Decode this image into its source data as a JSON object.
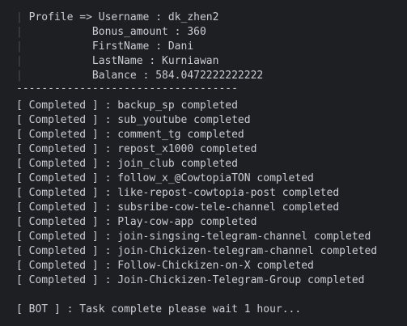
{
  "profile": {
    "prefix": "Profile => ",
    "bar": "|",
    "rows": [
      {
        "text": "Username : dk_zhen2"
      },
      {
        "text": "Bonus_amount : 360"
      },
      {
        "text": "FirstName : Dani"
      },
      {
        "text": "LastName : Kurniawan"
      },
      {
        "text": "Balance : 584.0472222222222"
      }
    ]
  },
  "divider": "-----------------------------------",
  "tasks": [
    {
      "status": "[ Completed ]",
      "text": " : backup_sp completed"
    },
    {
      "status": "[ Completed ]",
      "text": " : sub_youtube completed"
    },
    {
      "status": "[ Completed ]",
      "text": " : comment_tg completed"
    },
    {
      "status": "[ Completed ]",
      "text": " : repost_x1000 completed"
    },
    {
      "status": "[ Completed ]",
      "text": " : join_club completed"
    },
    {
      "status": "[ Completed ]",
      "text": " : follow_x_@CowtopiaTON completed"
    },
    {
      "status": "[ Completed ]",
      "text": " : like-repost-cowtopia-post completed"
    },
    {
      "status": "[ Completed ]",
      "text": " : subsribe-cow-tele-channel completed"
    },
    {
      "status": "[ Completed ]",
      "text": " : Play-cow-app completed"
    },
    {
      "status": "[ Completed ]",
      "text": " : join-singsing-telegram-channel completed"
    },
    {
      "status": "[ Completed ]",
      "text": " : join-Chickizen-telegram-channel completed"
    },
    {
      "status": "[ Completed ]",
      "text": " : Follow-Chickizen-on-X completed"
    },
    {
      "status": "[ Completed ]",
      "text": " : Join-Chickizen-Telegram-Group completed"
    }
  ],
  "bot": {
    "tag": "[ BOT ]",
    "text": " : Task complete please wait 1 hour..."
  }
}
